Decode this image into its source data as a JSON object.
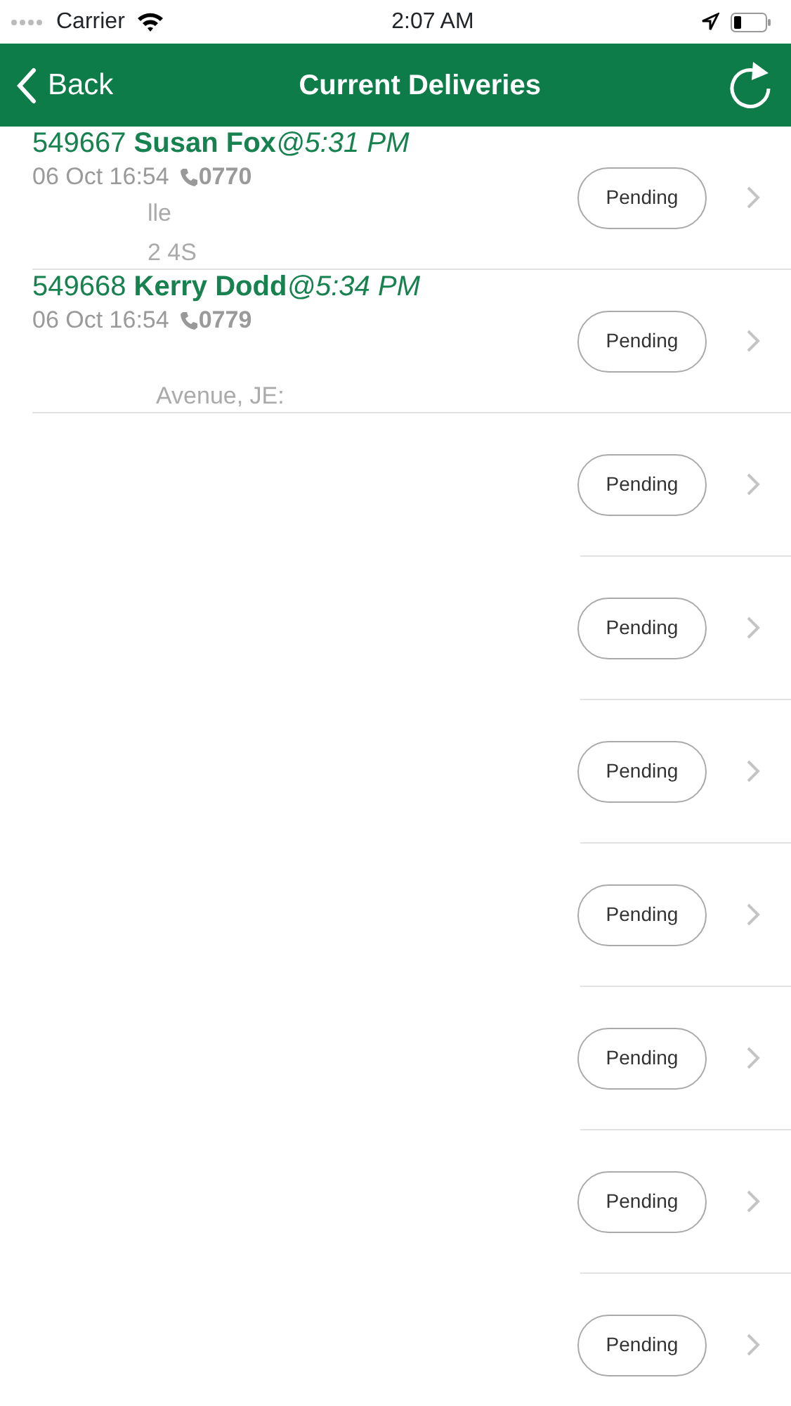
{
  "status_bar": {
    "carrier": "Carrier",
    "time": "2:07 AM"
  },
  "nav": {
    "back": "Back",
    "title": "Current Deliveries"
  },
  "deliveries": [
    {
      "kind": "detail",
      "id": "549667",
      "name": "Susan Fox",
      "eta": "@5:31 PM",
      "date": "06 Oct 16:54",
      "phone": "0770",
      "address_lines": [
        "lle",
        "2 4S"
      ],
      "status": "Pending"
    },
    {
      "kind": "detail",
      "id": "549668",
      "name": "Kerry Dodd",
      "eta": "@5:34 PM",
      "date": "06 Oct 16:54",
      "phone": "0779",
      "address_lines": [
        "Avenue, JE:"
      ],
      "status": "Pending"
    },
    {
      "kind": "blank",
      "status": "Pending"
    },
    {
      "kind": "blank",
      "status": "Pending"
    },
    {
      "kind": "blank",
      "status": "Pending"
    },
    {
      "kind": "blank",
      "status": "Pending"
    },
    {
      "kind": "blank",
      "status": "Pending"
    },
    {
      "kind": "blank",
      "status": "Pending"
    },
    {
      "kind": "blank",
      "status": "Pending"
    }
  ]
}
